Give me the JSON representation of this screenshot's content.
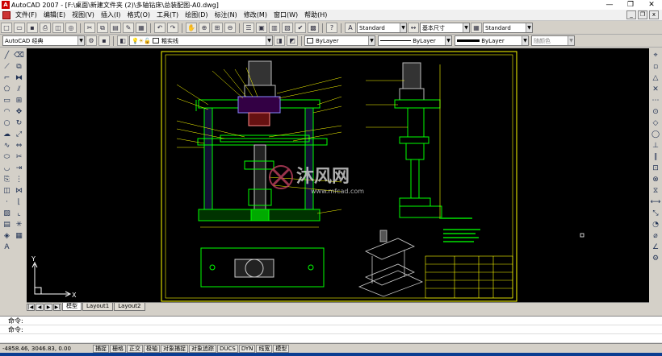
{
  "window": {
    "title": "AutoCAD 2007 - [F:\\桌面\\新建文件夹 (2)\\多轴钻床\\总装配图-A0.dwg]",
    "minimize": "—",
    "restore": "❐",
    "close": "✕"
  },
  "menu": [
    "文件(F)",
    "编辑(E)",
    "视图(V)",
    "插入(I)",
    "格式(O)",
    "工具(T)",
    "绘图(D)",
    "标注(N)",
    "修改(M)",
    "窗口(W)",
    "帮助(H)"
  ],
  "toolbar": {
    "text_style": "Standard",
    "dim_style": "基本尺寸",
    "table_style": "Standard",
    "workspace": "AutoCAD 经典",
    "layer": "粗实线",
    "color": "ByLayer",
    "linetype": "ByLayer",
    "lineweight": "ByLayer",
    "plot_style": "随颜色"
  },
  "colors": {
    "canvas": "#000000",
    "frame": "#ffff00",
    "geometry": "#00ff00",
    "leader": "#ffff00",
    "section": "#00ff00"
  },
  "watermark": {
    "brand": "沐风网",
    "url": "www.mfcad.com"
  },
  "tabs": [
    "模型",
    "Layout1",
    "Layout2"
  ],
  "nav_buttons": [
    "|◀",
    "◀",
    "▶",
    "▶|"
  ],
  "command": {
    "line1": "命令:",
    "line2": "命令:"
  },
  "status": {
    "coords": "-4858.46, 3046.83, 0.00",
    "buttons": [
      "捕捉",
      "栅格",
      "正交",
      "极轴",
      "对象捕捉",
      "对象追踪",
      "DUCS",
      "DYN",
      "线宽",
      "模型"
    ]
  },
  "ucs": {
    "x_label": "X",
    "y_label": "Y"
  }
}
